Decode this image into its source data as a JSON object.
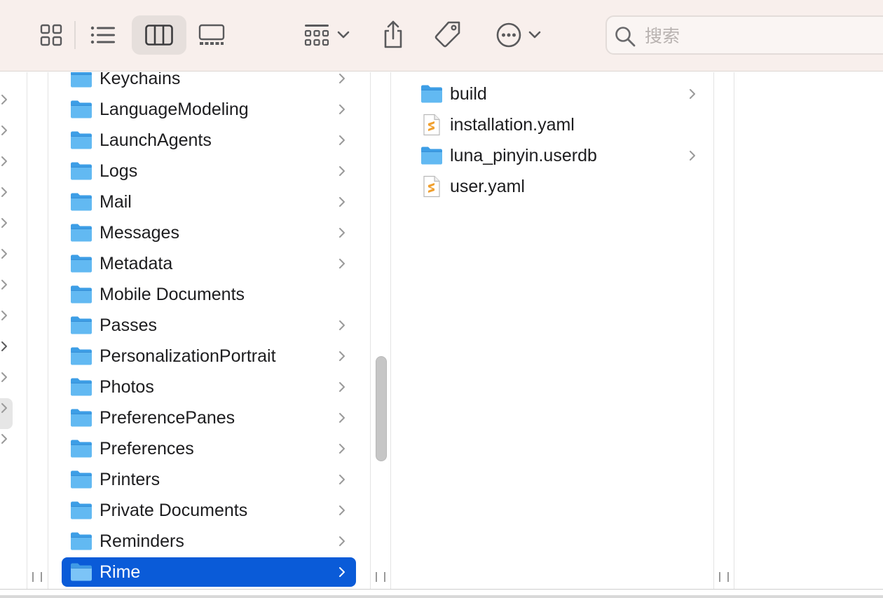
{
  "toolbar": {
    "view_buttons": [
      {
        "name": "icon-view-button",
        "icon": "grid-icon"
      },
      {
        "name": "list-view-button",
        "icon": "list-icon"
      },
      {
        "name": "column-view-button",
        "icon": "columns-icon",
        "active": true
      },
      {
        "name": "gallery-view-button",
        "icon": "gallery-icon"
      }
    ],
    "group_icon": "group-by-icon",
    "share_icon": "share-icon",
    "tag_icon": "tag-icon",
    "more_icon": "more-icon",
    "search": {
      "placeholder": "搜索",
      "value": ""
    }
  },
  "columns": {
    "library": {
      "items": [
        {
          "name": "Keychains",
          "type": "folder",
          "has_children": true
        },
        {
          "name": "LanguageModeling",
          "type": "folder",
          "has_children": true
        },
        {
          "name": "LaunchAgents",
          "type": "folder",
          "has_children": true
        },
        {
          "name": "Logs",
          "type": "folder",
          "has_children": true
        },
        {
          "name": "Mail",
          "type": "folder",
          "has_children": true
        },
        {
          "name": "Messages",
          "type": "folder",
          "has_children": true
        },
        {
          "name": "Metadata",
          "type": "folder",
          "has_children": true
        },
        {
          "name": "Mobile Documents",
          "type": "folder",
          "has_children": false
        },
        {
          "name": "Passes",
          "type": "folder",
          "has_children": true
        },
        {
          "name": "PersonalizationPortrait",
          "type": "folder",
          "has_children": true
        },
        {
          "name": "Photos",
          "type": "folder",
          "has_children": true
        },
        {
          "name": "PreferencePanes",
          "type": "folder",
          "has_children": true
        },
        {
          "name": "Preferences",
          "type": "folder",
          "has_children": true
        },
        {
          "name": "Printers",
          "type": "folder",
          "has_children": true
        },
        {
          "name": "Private Documents",
          "type": "folder",
          "has_children": true
        },
        {
          "name": "Reminders",
          "type": "folder",
          "has_children": true
        },
        {
          "name": "Rime",
          "type": "folder",
          "has_children": true,
          "selected": true
        }
      ]
    },
    "rime": {
      "items": [
        {
          "name": "build",
          "type": "folder",
          "has_children": true
        },
        {
          "name": "installation.yaml",
          "type": "yaml",
          "has_children": false
        },
        {
          "name": "luna_pinyin.userdb",
          "type": "folder",
          "has_children": true
        },
        {
          "name": "user.yaml",
          "type": "yaml",
          "has_children": false
        }
      ]
    }
  },
  "colors": {
    "toolbar_bg": "#f8efec",
    "selection": "#0a5bd8",
    "folder": "#5bb4f0",
    "yaml_accent": "#f0a030"
  }
}
